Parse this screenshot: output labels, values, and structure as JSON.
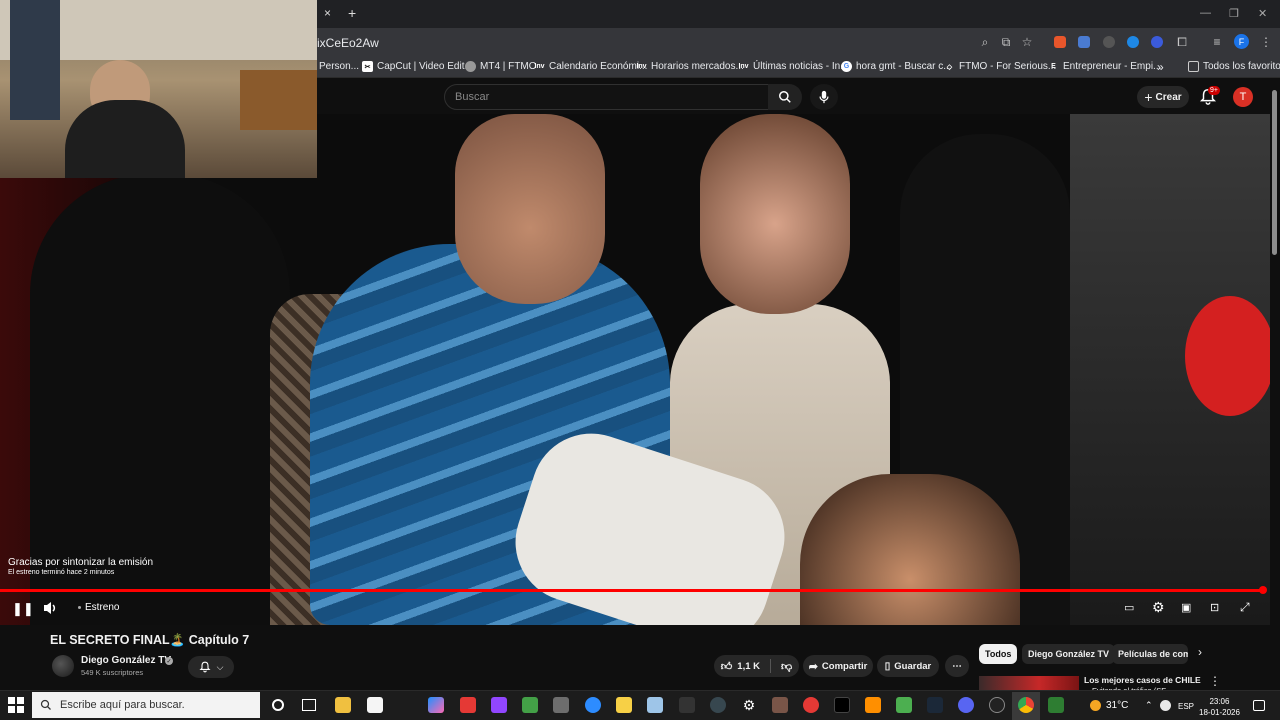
{
  "browser": {
    "url_fragment": "ixCeEo2Aw",
    "new_tab": "+",
    "close_tab": "×",
    "bookmarks": [
      {
        "label": "Person...",
        "icon": "bookmark-icon"
      },
      {
        "label": "CapCut | Video Edit...",
        "icon": "capcut-icon"
      },
      {
        "label": "MT4 | FTMO",
        "icon": "ftmo-icon"
      },
      {
        "label": "Calendario Económi...",
        "icon": "investing-icon"
      },
      {
        "label": "Horarios mercados...",
        "icon": "investing-icon"
      },
      {
        "label": "Últimas noticias - In...",
        "icon": "investing-icon"
      },
      {
        "label": "hora gmt - Buscar c...",
        "icon": "google-icon"
      },
      {
        "label": "FTMO - For Serious...",
        "icon": "ftmo-icon"
      },
      {
        "label": "Entrepreneur - Empi...",
        "icon": "entrepreneur-icon"
      }
    ],
    "bookmarks_more": "»",
    "all_bookmarks": "Todos los favoritos",
    "profile_initial": "F"
  },
  "youtube_header": {
    "search_placeholder": "Buscar",
    "create_label": "Crear",
    "notification_count": "9+",
    "avatar_initial": "T"
  },
  "player": {
    "caption_line1": "Gracias por sintonizar la emisión",
    "caption_line2": "El estreno terminó hace 2 minutos",
    "live_label": "Estreno",
    "progress": 1.0,
    "progress_color": "#ff0000"
  },
  "video": {
    "title": "EL SECRETO FINAL🏝️ Capítulo 7",
    "channel_name": "Diego González TV",
    "subscribers": "549 K suscriptores",
    "likes": "1,1 K",
    "share_label": "Compartir",
    "save_label": "Guardar"
  },
  "chips": [
    "Todos",
    "Diego González TV",
    "Películas de come"
  ],
  "recommendation": {
    "title": "Los mejores casos de CHILE",
    "subtitle": "Evitando el tráfico (SE"
  },
  "taskbar": {
    "search_placeholder": "Escribe aquí para buscar.",
    "temperature": "31°C",
    "language": "ESP",
    "time": "23:06",
    "date": "18-01-2026"
  },
  "colors": {
    "accent_red": "#ff0000",
    "background": "#0f0f0f",
    "chip_active": "#f1f1f1"
  }
}
